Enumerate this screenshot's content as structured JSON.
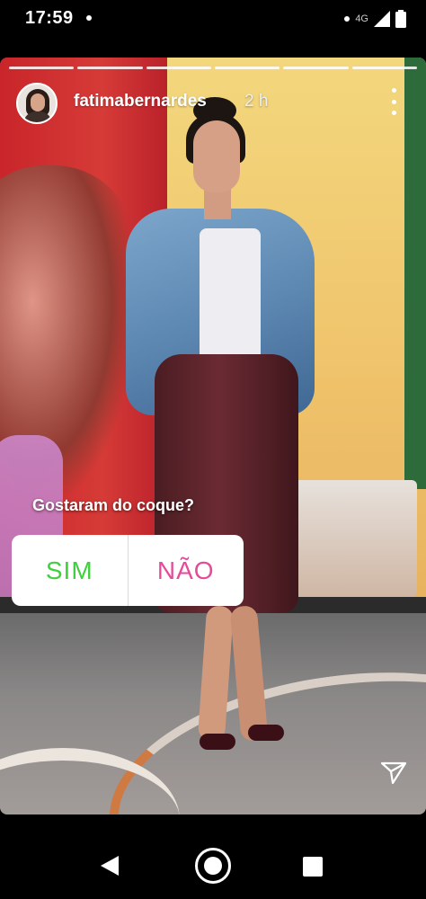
{
  "status_bar": {
    "time": "17:59",
    "network": "4G"
  },
  "story": {
    "progress_segments": 6,
    "username": "fatimabernardes",
    "time_ago": "2 h",
    "poll": {
      "question": "Gostaram do coque?",
      "option_yes": "SIM",
      "option_no": "NÃO"
    }
  },
  "colors": {
    "poll_yes": "#3ed13e",
    "poll_no": "#e84a9b"
  }
}
